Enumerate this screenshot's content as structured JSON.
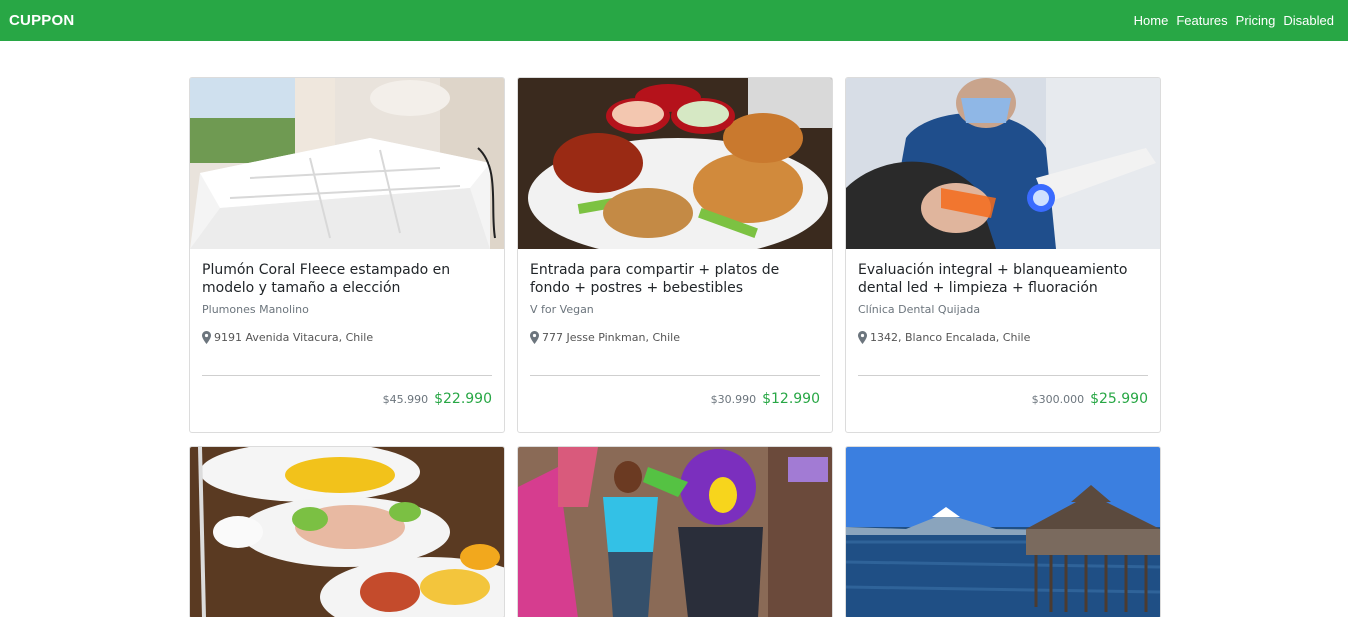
{
  "navbar": {
    "brand": "CUPPON",
    "links": [
      "Home",
      "Features",
      "Pricing",
      "Disabled"
    ],
    "color": "#28a745"
  },
  "deals": [
    {
      "title": "Plumón Coral Fleece estampado en modelo y tamaño a elección",
      "merchant": "Plumones Manolino",
      "address": "9191 Avenida Vitacura, Chile",
      "old_price": "$45.990",
      "new_price": "$22.990",
      "image": "bedroom-duvet-photo"
    },
    {
      "title": "Entrada para compartir + platos de fondo + postres + bebestibles",
      "merchant": "V for Vegan",
      "address": "777 Jesse Pinkman, Chile",
      "old_price": "$30.990",
      "new_price": "$12.990",
      "image": "appetizer-platter-photo"
    },
    {
      "title": "Evaluación integral + blanqueamiento dental led + limpieza + fluoración",
      "merchant": "Clínica Dental Quijada",
      "address": "1342, Blanco Encalada, Chile",
      "old_price": "$300.000",
      "new_price": "$25.990",
      "image": "dental-whitening-photo"
    },
    {
      "image": "seafood-dishes-photo"
    },
    {
      "image": "kids-party-mascot-photo"
    },
    {
      "image": "lake-pier-volcano-photo"
    }
  ]
}
